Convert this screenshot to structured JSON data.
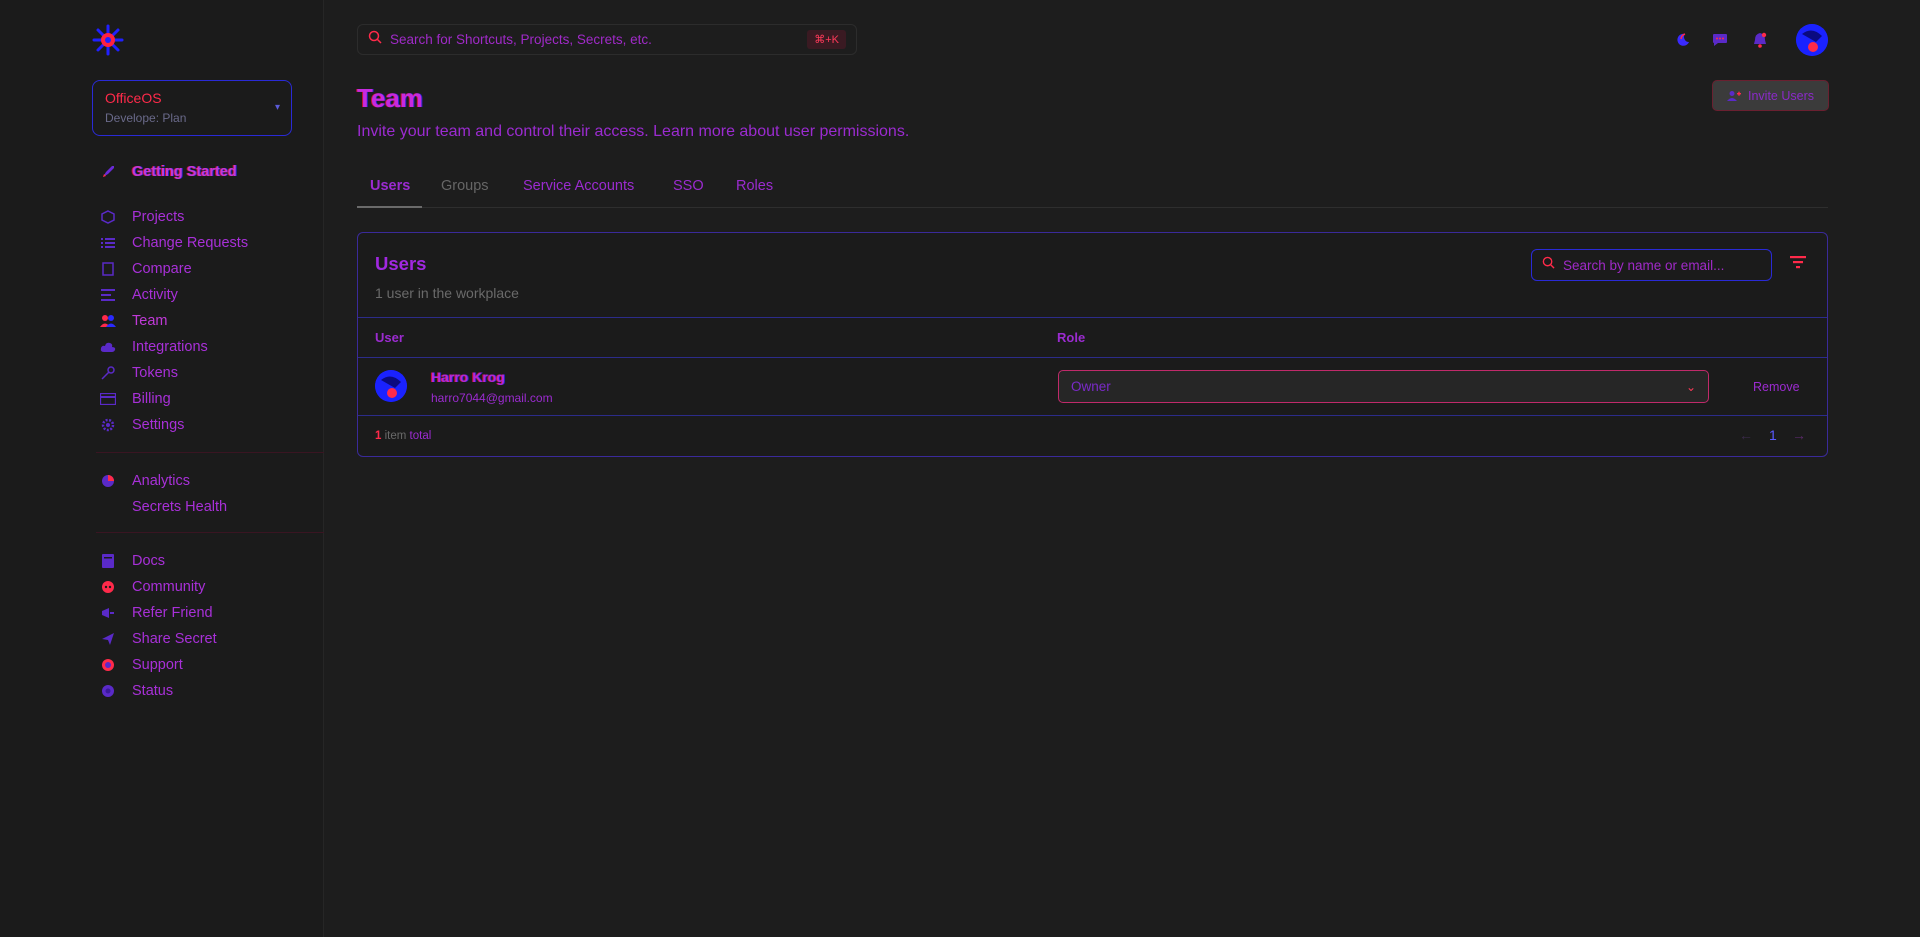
{
  "sidebar": {
    "org": {
      "name": "OfficeOS",
      "plan": "Develope: Plan"
    },
    "getting_started": "Getting Started",
    "main_items": [
      {
        "label": "Projects",
        "icon": "cube-icon"
      },
      {
        "label": "Change Requests",
        "icon": "list-icon"
      },
      {
        "label": "Compare",
        "icon": "compare-icon"
      },
      {
        "label": "Activity",
        "icon": "activity-icon"
      },
      {
        "label": "Team",
        "icon": "team-icon"
      },
      {
        "label": "Integrations",
        "icon": "cloud-icon"
      },
      {
        "label": "Tokens",
        "icon": "key-icon"
      },
      {
        "label": "Billing",
        "icon": "card-icon"
      },
      {
        "label": "Settings",
        "icon": "gear-icon"
      }
    ],
    "analytics_items": [
      {
        "label": "Analytics",
        "icon": "pie-chart-icon"
      },
      {
        "label": "Secrets Health",
        "icon": ""
      }
    ],
    "footer_items": [
      {
        "label": "Docs",
        "icon": "book-icon"
      },
      {
        "label": "Community",
        "icon": "discord-icon"
      },
      {
        "label": "Refer Friend",
        "icon": "megaphone-icon"
      },
      {
        "label": "Share Secret",
        "icon": "send-icon"
      },
      {
        "label": "Support",
        "icon": "help-icon"
      },
      {
        "label": "Status",
        "icon": "status-icon"
      }
    ]
  },
  "topbar": {
    "search_placeholder": "Search for Shortcuts, Projects, Secrets, etc.",
    "shortcut": "⌘+K"
  },
  "header": {
    "title": "Team",
    "subtitle": "Invite your team and control their access. Learn more about user permissions.",
    "invite_label": "Invite Users"
  },
  "tabs": [
    "Users",
    "Groups",
    "Service Accounts",
    "SSO",
    "Roles"
  ],
  "users_card": {
    "title": "Users",
    "subtitle": "1 user in the workplace",
    "search_placeholder": "Search by name or email...",
    "columns": [
      "User",
      "Role"
    ],
    "rows": [
      {
        "name": "Harro Krog",
        "email": "harro7044@gmail.com",
        "role": "Owner",
        "action": "Remove"
      }
    ],
    "footer": {
      "count": "1",
      "item_label": "item",
      "total_label": "total",
      "page": "1"
    }
  },
  "colors": {
    "accent": "#9b2bd0",
    "brand_red": "#ff2a4a",
    "brand_blue": "#1a22ff",
    "background": "#1d1d1d"
  }
}
